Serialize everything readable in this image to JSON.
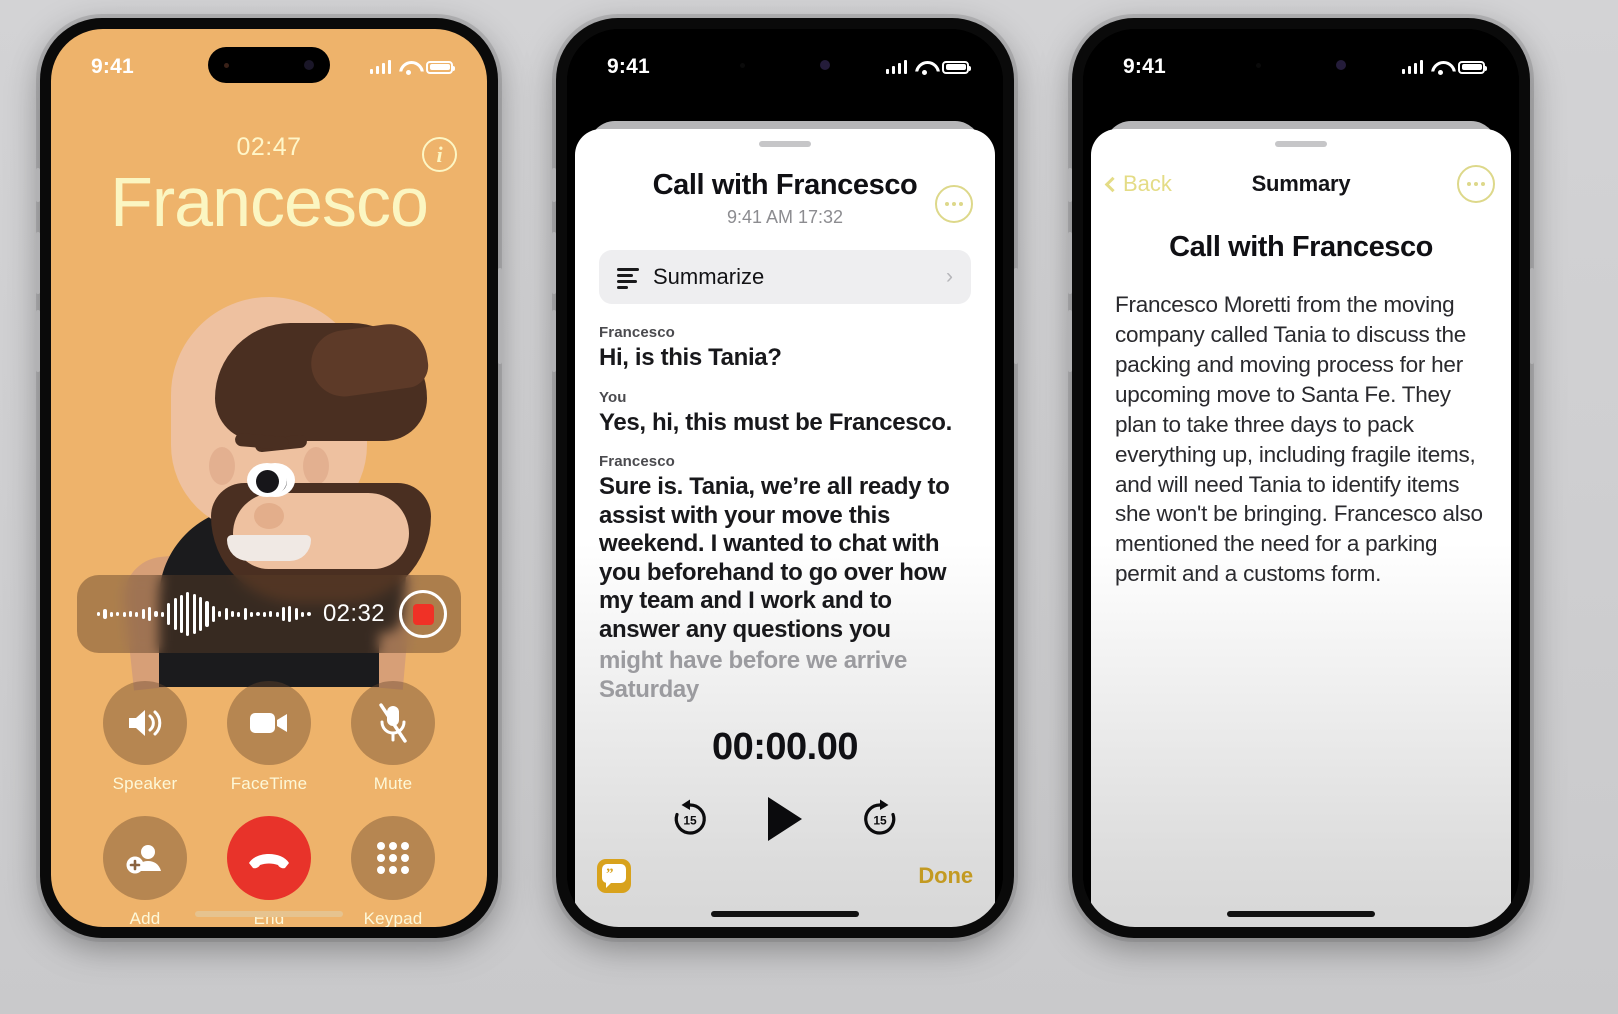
{
  "phone1": {
    "status": {
      "time": "9:41",
      "signal_icon": "cellular-signal-icon",
      "wifi_icon": "wifi-icon",
      "battery_icon": "battery-icon"
    },
    "call": {
      "duration": "02:47",
      "contact_name": "Francesco",
      "info_icon": "info-icon"
    },
    "recording": {
      "elapsed": "02:32",
      "stop_icon": "stop-record-icon",
      "waveform": [
        4,
        10,
        5,
        4,
        5,
        6,
        5,
        10,
        14,
        6,
        5,
        22,
        32,
        38,
        44,
        40,
        34,
        26,
        16,
        6,
        12,
        6,
        5,
        12,
        5,
        4,
        5,
        6,
        5,
        14,
        16,
        12,
        5,
        4
      ]
    },
    "controls": [
      {
        "label": "Speaker",
        "icon": "speaker-icon",
        "active": false
      },
      {
        "label": "FaceTime",
        "icon": "video-camera-icon",
        "active": false
      },
      {
        "label": "Mute",
        "icon": "microphone-muted-icon",
        "active": false
      },
      {
        "label": "Add",
        "icon": "add-person-icon",
        "active": false
      },
      {
        "label": "End",
        "icon": "end-call-icon",
        "active": true
      },
      {
        "label": "Keypad",
        "icon": "keypad-icon",
        "active": false
      }
    ]
  },
  "phone2": {
    "status": {
      "time": "9:41"
    },
    "sheet": {
      "title": "Call with Francesco",
      "subtitle": "9:41 AM  17:32",
      "more_icon": "more-options-icon",
      "summarize": {
        "label": "Summarize",
        "icon": "summarize-icon",
        "chevron": "›"
      },
      "transcript": [
        {
          "speaker": "Francesco",
          "text": "Hi, is this Tania?",
          "faded": false
        },
        {
          "speaker": "You",
          "text": "Yes, hi, this must be Francesco.",
          "faded": false
        },
        {
          "speaker": "Francesco",
          "text": "Sure is. Tania, we’re all ready to assist with your move this weekend. I wanted to chat with you beforehand to go over how my team and I work and to answer any questions you",
          "faded": false
        },
        {
          "speaker": "",
          "text": "might have before we arrive Saturday",
          "faded": true
        }
      ],
      "player": {
        "position": "00:00.00",
        "skip_back_label": "15",
        "skip_forward_label": "15",
        "play_icon": "play-icon",
        "skip_back_icon": "skip-back-15-icon",
        "skip_forward_icon": "skip-forward-15-icon"
      },
      "footer": {
        "transcript_icon": "transcript-bubble-icon",
        "done_label": "Done"
      }
    }
  },
  "phone3": {
    "status": {
      "time": "9:41"
    },
    "nav": {
      "back_label": "Back",
      "title": "Summary",
      "more_icon": "more-options-icon",
      "back_icon": "chevron-left-icon"
    },
    "summary": {
      "heading": "Call with Francesco",
      "body": "Francesco Moretti from the moving company called Tania to discuss the packing and moving process for her upcoming move to Santa Fe. They plan to take three days to pack everything up, including fragile items, and will need Tania to identify items she won't be bringing. Francesco also mentioned the need for a parking permit and a customs form."
    }
  },
  "colors": {
    "call_background": "#eeb36b",
    "call_name": "#fbf6c2",
    "end_call": "#e8332a",
    "accent_gold": "#c39a22",
    "nav_accent": "#e4dc86",
    "page_background": "#d0d0d2"
  }
}
